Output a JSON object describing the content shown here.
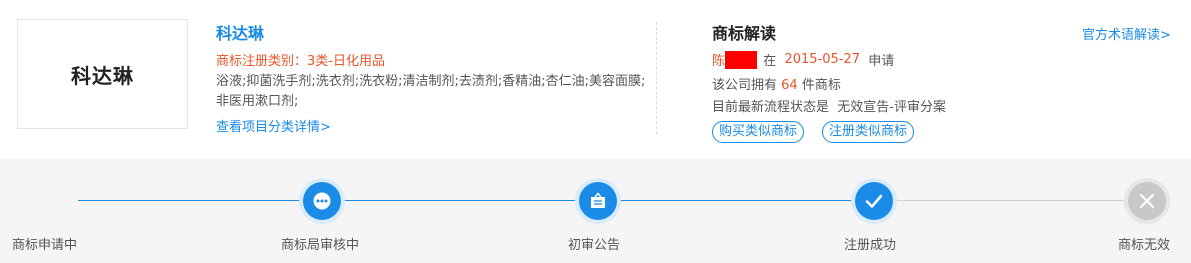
{
  "trademark": {
    "logo_text": "科达琳",
    "name": "科达琳",
    "category": "商标注册类别：3类-日化用品",
    "goods": "浴液;抑菌洗手剂;洗衣剂;洗衣粉;清洁制剂;去渍剂;香精油;杏仁油;美容面膜;非医用漱口剂;",
    "detail_link": "查看项目分类详情>"
  },
  "interpretation": {
    "title": "商标解读",
    "official_link": "官方术语解读>",
    "applicant_prefix": "陈",
    "applicant_at": " 在  ",
    "apply_date": "2015-05-27",
    "apply_suffix": "  申请",
    "count_prefix": "该公司拥有 ",
    "count": "64",
    "count_suffix": " 件商标",
    "status_text": "目前最新流程状态是  无效宣告-评审分案",
    "buy_button": "购买类似商标",
    "register_button": "注册类似商标"
  },
  "progress": {
    "steps": [
      {
        "label": "商标申请中",
        "icon": "none",
        "state": "done"
      },
      {
        "label": "商标局审核中",
        "icon": "ellipsis-icon",
        "state": "done"
      },
      {
        "label": "初审公告",
        "icon": "notice-board-icon",
        "state": "done"
      },
      {
        "label": "注册成功",
        "icon": "check-icon",
        "state": "done"
      },
      {
        "label": "商标无效",
        "icon": "close-icon",
        "state": "inactive"
      }
    ],
    "colors": {
      "active": "#1a8be6",
      "inactive": "#c8c8c8"
    }
  }
}
